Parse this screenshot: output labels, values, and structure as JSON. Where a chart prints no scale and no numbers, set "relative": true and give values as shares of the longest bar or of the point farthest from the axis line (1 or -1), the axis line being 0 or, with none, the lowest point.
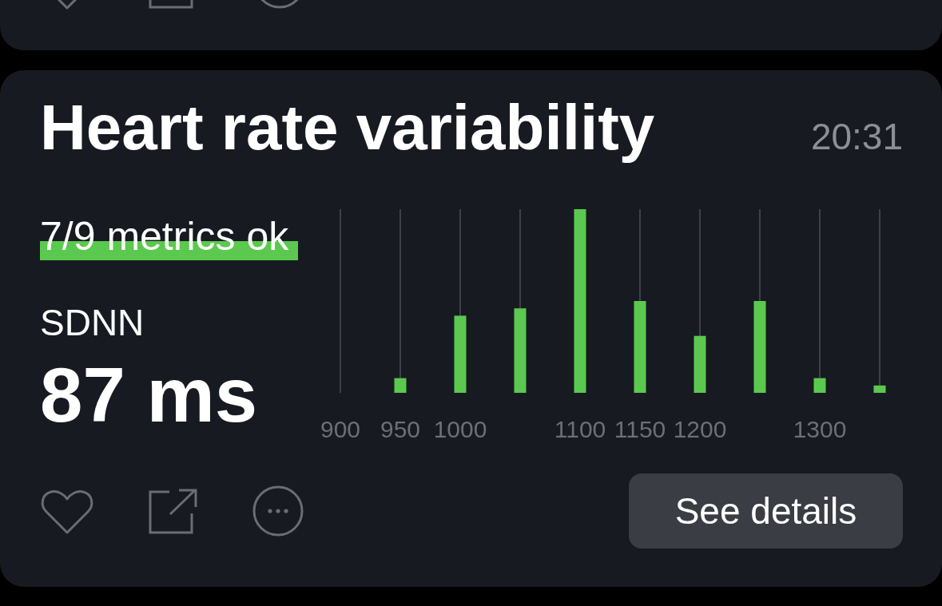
{
  "card": {
    "title": "Heart rate variability",
    "time": "20:31",
    "metrics_status": {
      "text": "7/9 metrics ok",
      "highlighted": true
    },
    "metric": {
      "label": "SDNN",
      "value": "87 ms"
    },
    "chart_data": {
      "type": "bar",
      "x": [
        950,
        1000,
        1050,
        1100,
        1150,
        1200,
        1250,
        1300,
        1350
      ],
      "values": [
        0.08,
        0.42,
        0.46,
        1.0,
        0.5,
        0.31,
        0.5,
        0.08,
        0.04
      ],
      "relative": true,
      "xlim": [
        900,
        1350
      ],
      "xticks": [
        900,
        950,
        1000,
        1100,
        1150,
        1200,
        1300
      ],
      "grid": true
    },
    "button": "See details"
  }
}
